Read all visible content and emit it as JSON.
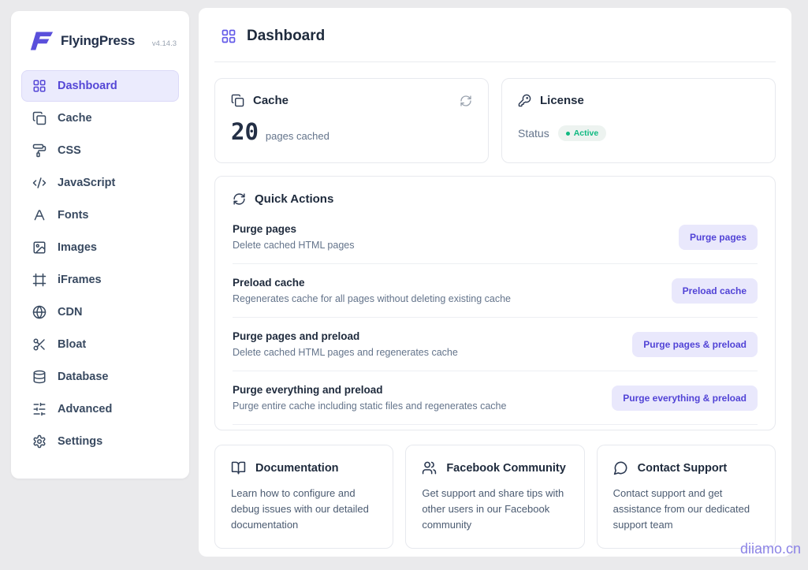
{
  "app": {
    "name": "FlyingPress",
    "version": "v4.14.3",
    "watermark": "diiamo.cn"
  },
  "header": {
    "title": "Dashboard"
  },
  "sidebar": {
    "items": [
      {
        "icon": "grid",
        "label": "Dashboard",
        "active": true
      },
      {
        "icon": "copy",
        "label": "Cache",
        "active": false
      },
      {
        "icon": "paint-roller",
        "label": "CSS",
        "active": false
      },
      {
        "icon": "code",
        "label": "JavaScript",
        "active": false
      },
      {
        "icon": "letter-a",
        "label": "Fonts",
        "active": false
      },
      {
        "icon": "image",
        "label": "Images",
        "active": false
      },
      {
        "icon": "frame",
        "label": "iFrames",
        "active": false
      },
      {
        "icon": "globe",
        "label": "CDN",
        "active": false
      },
      {
        "icon": "scissors",
        "label": "Bloat",
        "active": false
      },
      {
        "icon": "database",
        "label": "Database",
        "active": false
      },
      {
        "icon": "sliders",
        "label": "Advanced",
        "active": false
      },
      {
        "icon": "gear",
        "label": "Settings",
        "active": false
      }
    ]
  },
  "cards": {
    "cache": {
      "title": "Cache",
      "count": "20",
      "suffix": "pages cached"
    },
    "license": {
      "title": "License",
      "status_label": "Status",
      "status_value": "Active"
    }
  },
  "quick_actions": {
    "title": "Quick Actions",
    "rows": [
      {
        "title": "Purge pages",
        "description": "Delete cached HTML pages",
        "button": "Purge pages"
      },
      {
        "title": "Preload cache",
        "description": "Regenerates cache for all pages without deleting existing cache",
        "button": "Preload cache"
      },
      {
        "title": "Purge pages and preload",
        "description": "Delete cached HTML pages and regenerates cache",
        "button": "Purge pages & preload"
      },
      {
        "title": "Purge everything and preload",
        "description": "Purge entire cache including static files and regenerates cache",
        "button": "Purge everything & preload"
      }
    ]
  },
  "info_cards": [
    {
      "icon": "book",
      "title": "Documentation",
      "description": "Learn how to configure and debug issues with our detailed documentation"
    },
    {
      "icon": "users",
      "title": "Facebook Community",
      "description": "Get support and share tips with other users in our Facebook community"
    },
    {
      "icon": "chat",
      "title": "Contact Support",
      "description": "Contact support and get assistance from our dedicated support team"
    }
  ],
  "colors": {
    "accent": "#5a4fdb",
    "accent_button_bg": "#e9e8fc",
    "accent_button_text": "#5143d6",
    "active_item_bg": "#ebebfd",
    "status_green": "#10b981",
    "text_dark": "#1e2a3c",
    "text_gray": "#64748b",
    "background": "#eaeaec"
  }
}
